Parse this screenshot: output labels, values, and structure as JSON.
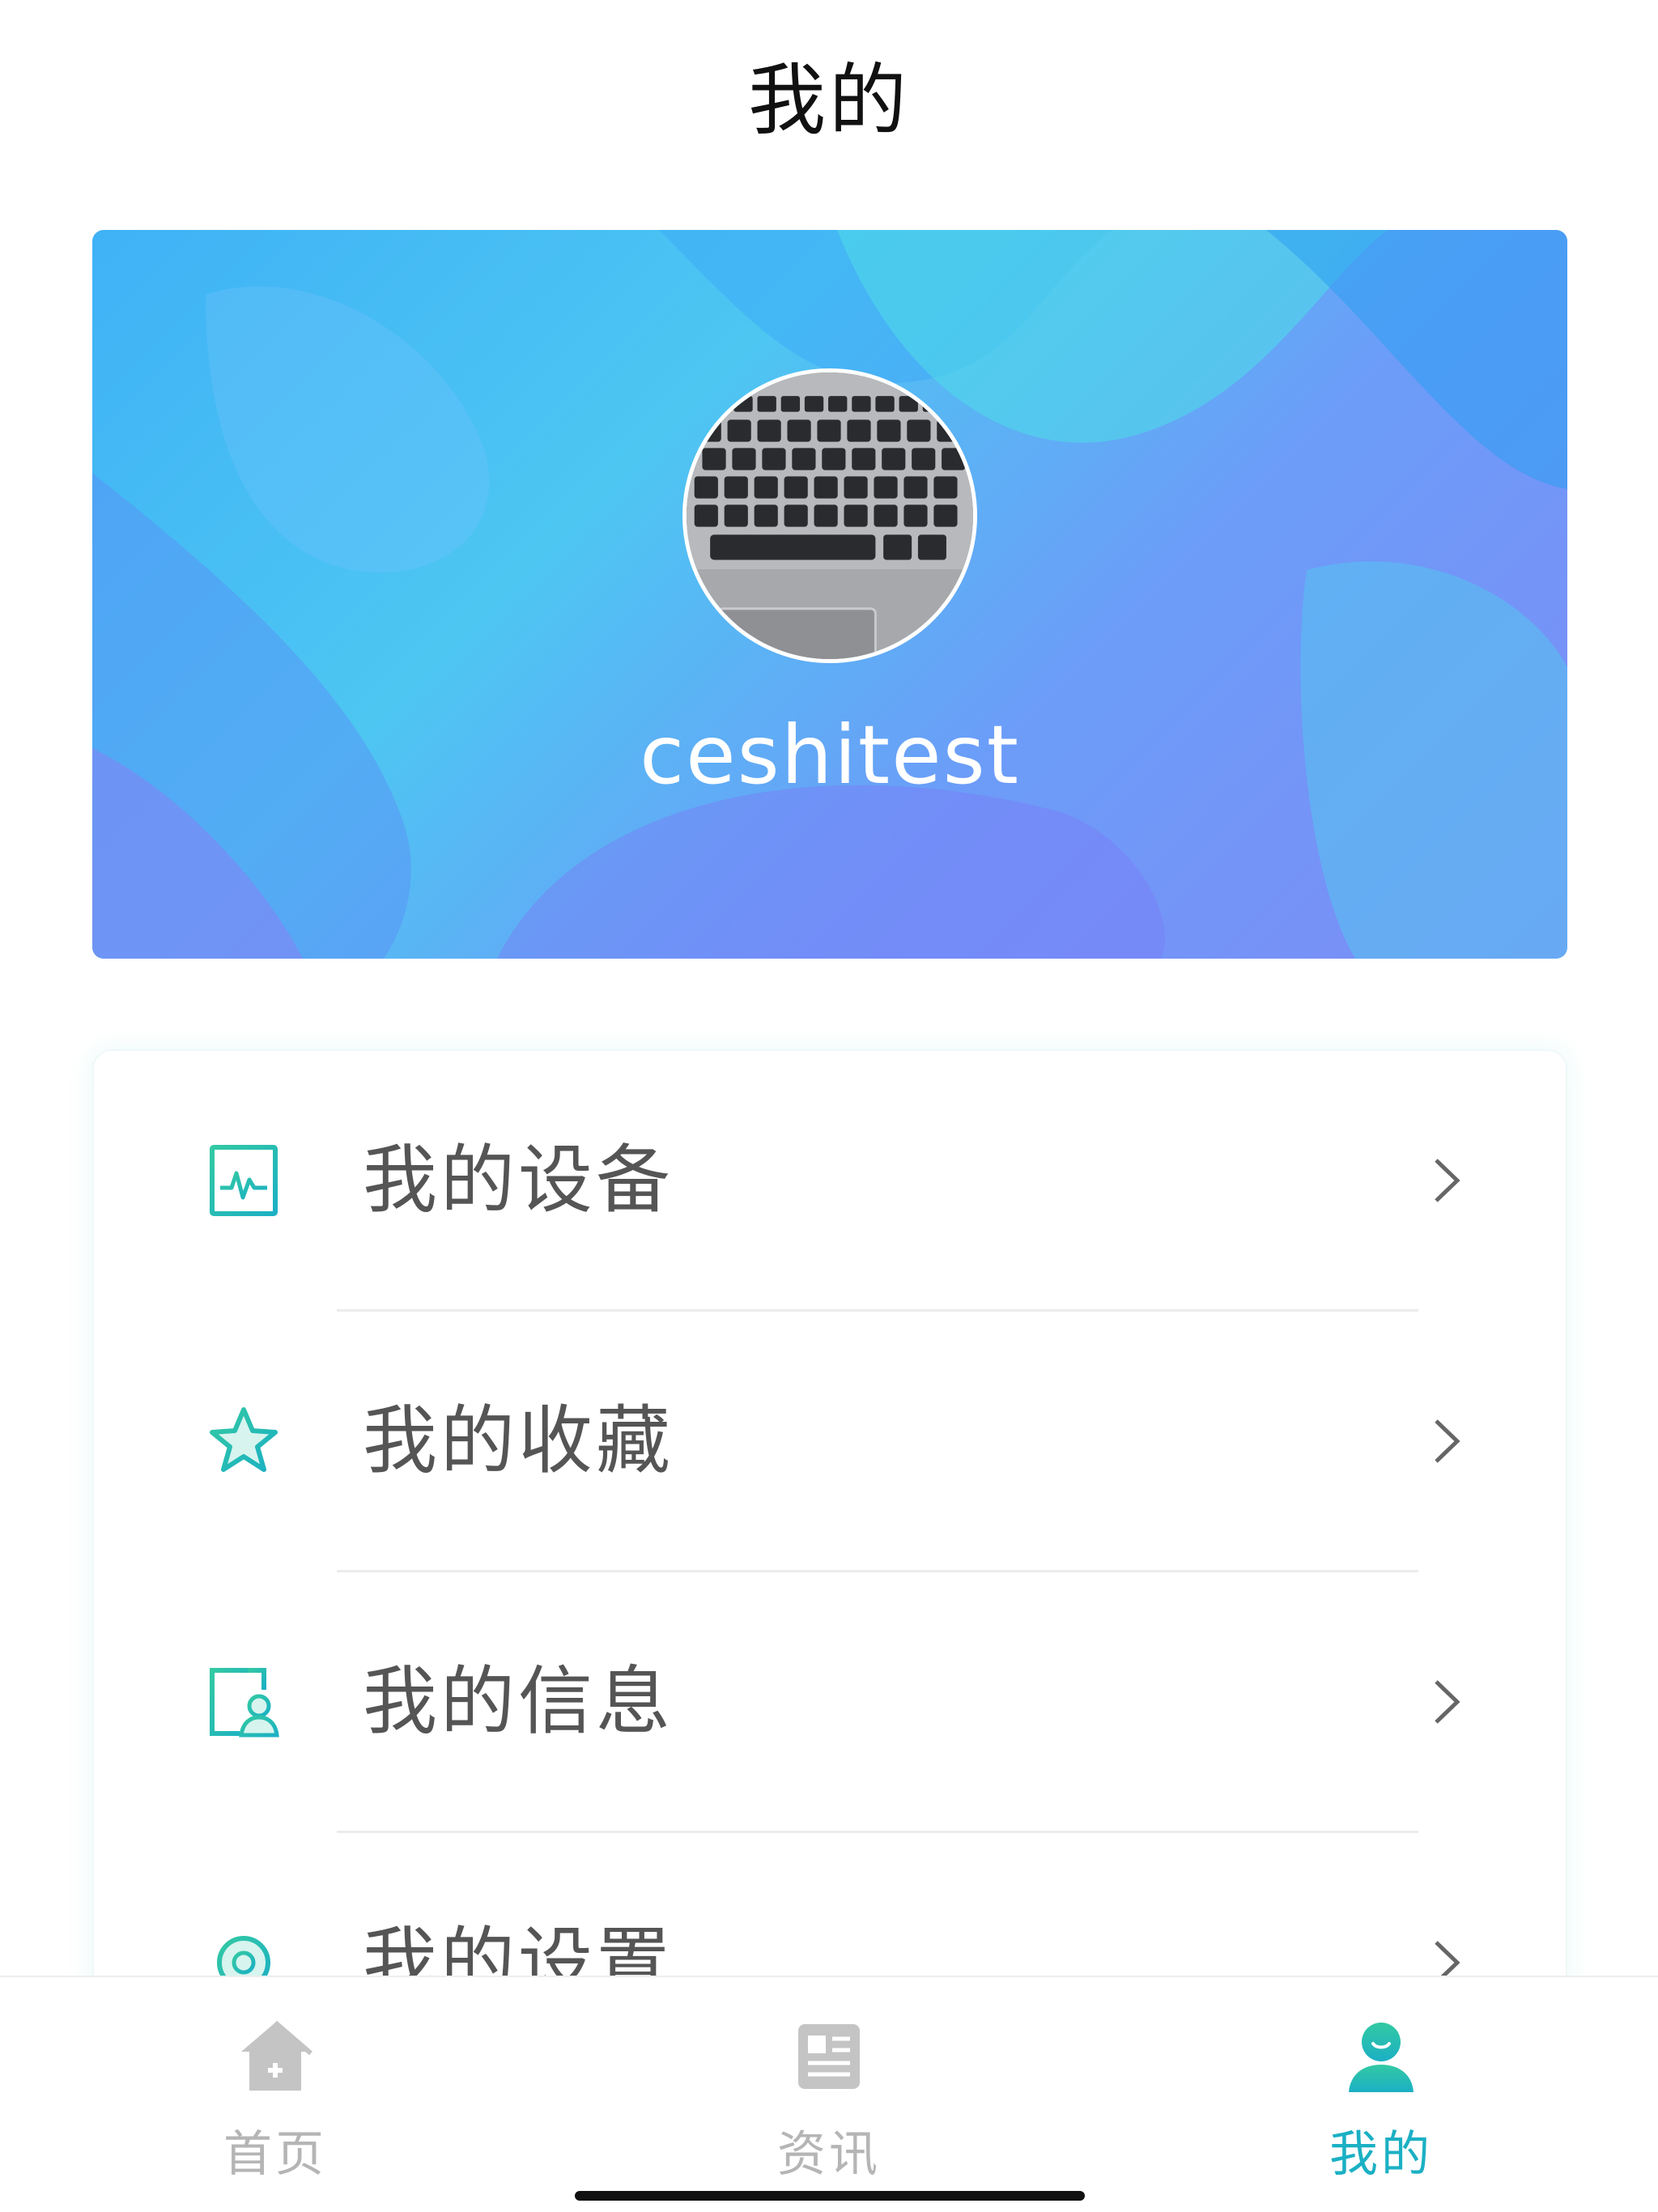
{
  "header": {
    "title": "我的"
  },
  "profile": {
    "username": "ceshitest",
    "avatar_icon": "avatar-photo-keyboard"
  },
  "menu": {
    "items": [
      {
        "label": "我的设备",
        "icon": "device-monitor-icon"
      },
      {
        "label": "我的收藏",
        "icon": "star-icon"
      },
      {
        "label": "我的信息",
        "icon": "user-info-icon"
      },
      {
        "label": "我的设置",
        "icon": "gear-icon"
      }
    ]
  },
  "tabbar": {
    "tabs": [
      {
        "label": "首页",
        "icon": "home-icon",
        "active": false
      },
      {
        "label": "资讯",
        "icon": "news-icon",
        "active": false
      },
      {
        "label": "我的",
        "icon": "user-icon",
        "active": true
      }
    ]
  },
  "colors": {
    "accent": "#1bb0c4",
    "icon_teal": "#2ec4a9",
    "inactive_tab": "#b5b5b5",
    "banner_start": "#3fb2f6",
    "banner_end": "#7d8cf6"
  }
}
